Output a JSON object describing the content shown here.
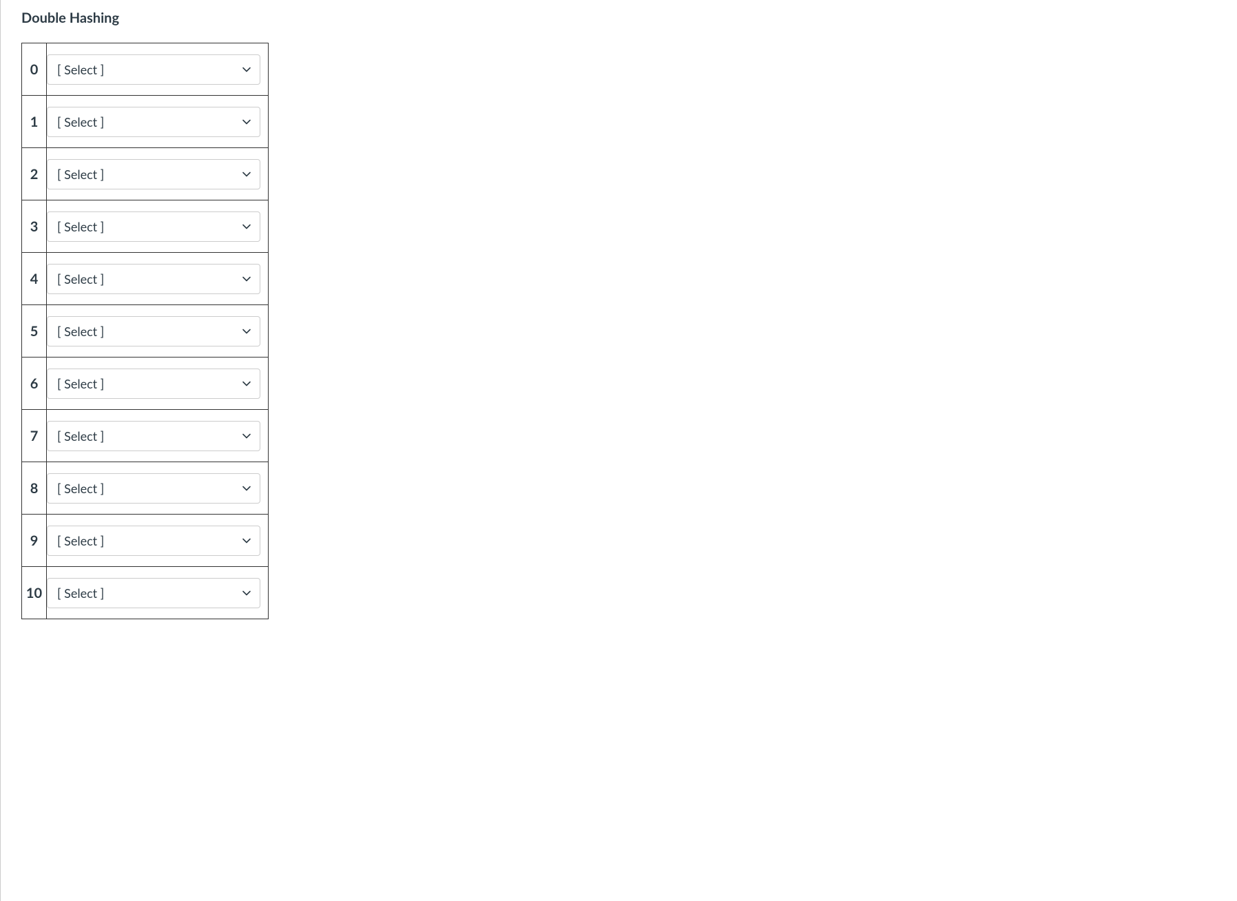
{
  "title": "Double Hashing",
  "select_placeholder": "[ Select ]",
  "rows": [
    {
      "index": "0"
    },
    {
      "index": "1"
    },
    {
      "index": "2"
    },
    {
      "index": "3"
    },
    {
      "index": "4"
    },
    {
      "index": "5"
    },
    {
      "index": "6"
    },
    {
      "index": "7"
    },
    {
      "index": "8"
    },
    {
      "index": "9"
    },
    {
      "index": "10"
    }
  ]
}
